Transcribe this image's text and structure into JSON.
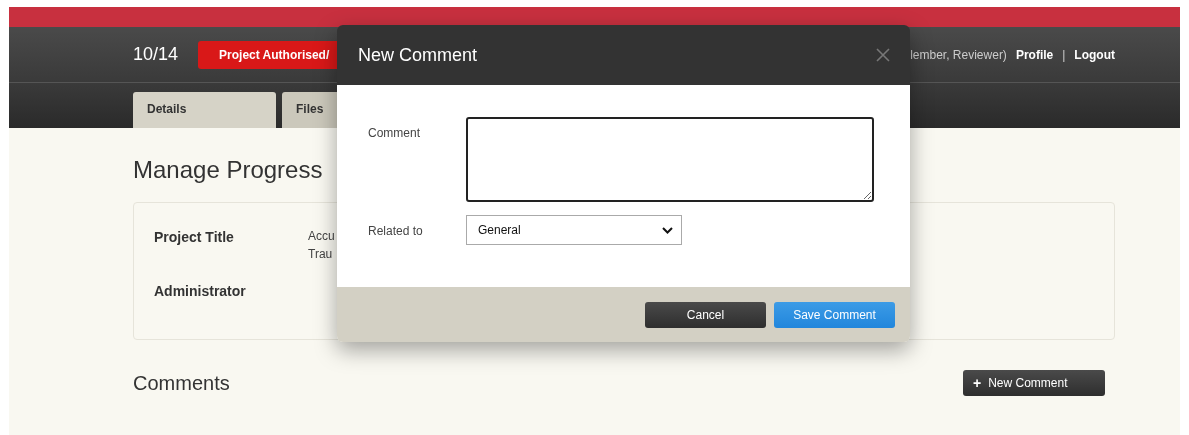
{
  "header": {
    "counter": "10/14",
    "status_badge": "Project Authorised/",
    "user_roles": "lember, Reviewer)",
    "links": [
      {
        "label": "Profile"
      },
      {
        "label": "Logout"
      }
    ],
    "separator": "|"
  },
  "tabs": [
    {
      "label": "Details",
      "selected": true
    },
    {
      "label": "Files",
      "selected": false
    }
  ],
  "page": {
    "title": "Manage Progress",
    "details": [
      {
        "label": "Project Title",
        "value": [
          "Accu",
          "Trau"
        ]
      },
      {
        "label": "Administrator"
      }
    ],
    "comments_heading": "Comments",
    "new_comment_button": {
      "icon": "+",
      "label": "New Comment"
    }
  },
  "dialog": {
    "title": "New Comment",
    "fields": [
      {
        "kind": "textarea",
        "label": "Comment"
      },
      {
        "kind": "select",
        "label": "Related to",
        "value": "General"
      }
    ],
    "buttons": [
      {
        "kind": "secondary",
        "label": "Cancel"
      },
      {
        "kind": "primary",
        "label": "Save Comment"
      }
    ]
  }
}
